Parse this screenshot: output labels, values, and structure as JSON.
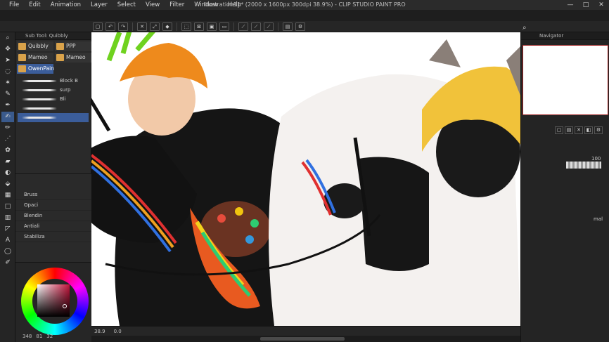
{
  "app": {
    "doc_title": "Illustration11* (2000 x 1600px 300dpi 38.9%) - CLIP STUDIO PAINT PRO"
  },
  "menu": [
    "File",
    "Edit",
    "Animation",
    "Layer",
    "Select",
    "View",
    "Filter",
    "Window",
    "Help"
  ],
  "window_controls": {
    "minimize": "—",
    "maximize": "□",
    "close": "✕"
  },
  "subtool": {
    "header": "Sub Tool: Quibbly",
    "tabs": [
      {
        "label": "Quibbly",
        "active": false
      },
      {
        "label": "PPP",
        "active": false
      },
      {
        "label": "Mameo",
        "active": false
      },
      {
        "label": "Mameo",
        "active": false
      },
      {
        "label": "OwenPain",
        "active": true
      }
    ],
    "brushes": [
      "Block B",
      "surp",
      "Bli",
      "",
      ""
    ]
  },
  "tool_properties": [
    "Bruss",
    "Opaci",
    "Blendin",
    "Antiali",
    "Stabiliza"
  ],
  "colors": {
    "main": "#6b1a2c",
    "sub": "#ffffff",
    "hsv": [
      "348",
      "81",
      "32"
    ]
  },
  "status": {
    "zoom": "38.9",
    "angle": "0.0"
  },
  "navigator": {
    "header": "Navigator"
  },
  "layer": {
    "opacity": "100",
    "partial_label": "mal"
  }
}
